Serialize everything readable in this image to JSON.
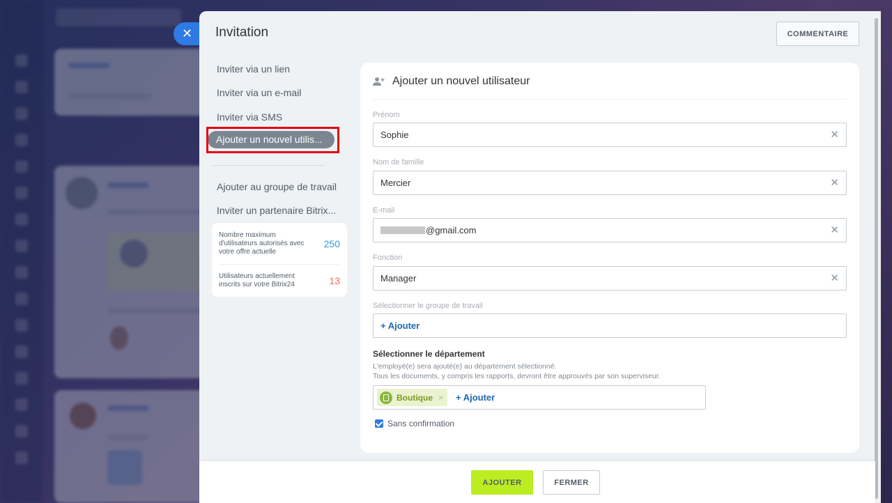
{
  "window": {
    "title": "Invitation",
    "comment_button": "COMMENTAIRE",
    "close_icon": "close-icon"
  },
  "menu": {
    "items": [
      {
        "label": "Inviter via un lien"
      },
      {
        "label": "Inviter via un e-mail"
      },
      {
        "label": "Inviter via SMS"
      },
      {
        "label": "Ajouter un nouvel utilis..."
      },
      {
        "label": "Ajouter au groupe de travail"
      },
      {
        "label": "Inviter un partenaire Bitrix..."
      }
    ],
    "active_index": 3
  },
  "limits": {
    "max_label": "Nombre maximum d'utilisateurs autorisés avec votre offre actuelle",
    "max_value": "250",
    "current_label": "Utilisateurs actuellement inscrits sur votre Bitrix24",
    "current_value": "13",
    "max_color": "#2f9ad8",
    "current_color": "#f06a5a"
  },
  "form": {
    "header": "Ajouter un nouvel utilisateur",
    "first_name_label": "Prénom",
    "first_name_value": "Sophie",
    "last_name_label": "Nom de famille",
    "last_name_value": "Mercier",
    "email_label": "E-mail",
    "email_value": "@gmail.com",
    "position_label": "Fonction",
    "position_value": "Manager",
    "workgroup_label": "Sélectionner le groupe de travail",
    "add_link": "+ Ajouter",
    "department_title": "Sélectionner le département",
    "department_desc_1": "L'employé(e) sera ajouté(e) au département sélectionné.",
    "department_desc_2": "Tous les documents, y compris les rapports, devront être approuvés par son superviseur.",
    "department_tag": "Boutique",
    "department_add": "+ Ajouter",
    "no_confirmation_label": "Sans confirmation",
    "no_confirmation_checked": true
  },
  "footer": {
    "add_button": "AJOUTER",
    "close_button": "FERMER"
  },
  "colors": {
    "accent": "#2f7ae5",
    "add_button": "#bbed21",
    "highlight": "#e60012"
  }
}
